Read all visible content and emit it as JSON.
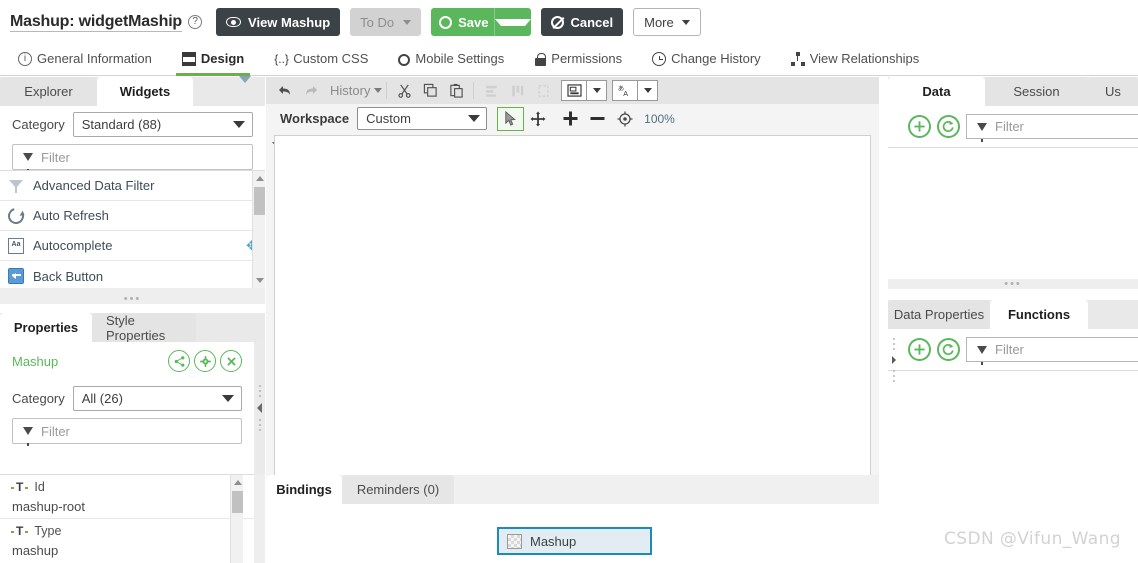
{
  "header": {
    "title_prefix": "Mashup:",
    "title_name": "widgetMaship",
    "help_icon": "question-circle-icon",
    "buttons": {
      "view_mashup": "View Mashup",
      "to_do": "To Do",
      "save": "Save",
      "cancel": "Cancel",
      "more": "More"
    }
  },
  "nav_tabs": [
    {
      "label": "General Information",
      "icon": "info-icon",
      "active": false
    },
    {
      "label": "Design",
      "icon": "design-icon",
      "active": true
    },
    {
      "label": "Custom CSS",
      "icon": "css-braces-icon",
      "active": false
    },
    {
      "label": "Mobile Settings",
      "icon": "gear-icon",
      "active": false
    },
    {
      "label": "Permissions",
      "icon": "lock-icon",
      "active": false
    },
    {
      "label": "Change History",
      "icon": "clock-icon",
      "active": false
    },
    {
      "label": "View Relationships",
      "icon": "hierarchy-icon",
      "active": false
    }
  ],
  "widgets_panel": {
    "tabs": [
      {
        "label": "Explorer",
        "active": false
      },
      {
        "label": "Widgets",
        "active": true
      }
    ],
    "collapse_icon": "chevron-down-icon",
    "category_label": "Category",
    "category_value": "Standard (88)",
    "filter_placeholder": "Filter",
    "items": [
      {
        "label": "Advanced Data Filter",
        "icon": "funnel-icon",
        "draggable": false
      },
      {
        "label": "Auto Refresh",
        "icon": "refresh-icon",
        "draggable": false
      },
      {
        "label": "Autocomplete",
        "icon": "autocomplete-icon",
        "draggable": true
      },
      {
        "label": "Back Button",
        "icon": "back-button-icon",
        "draggable": false
      }
    ]
  },
  "properties_panel": {
    "tabs": [
      {
        "label": "Properties",
        "active": true
      },
      {
        "label": "Style Properties",
        "active": false
      }
    ],
    "entity_name": "Mashup",
    "actions": [
      {
        "name": "share-button",
        "icon": "share-icon"
      },
      {
        "name": "configure-button",
        "icon": "gear-icon"
      },
      {
        "name": "close-button",
        "icon": "close-icon"
      }
    ],
    "category_label": "Category",
    "category_value": "All (26)",
    "filter_placeholder": "Filter",
    "rows": [
      {
        "key": "Id",
        "value": "mashup-root",
        "icon": "text-type-icon"
      },
      {
        "key": "Type",
        "value": "mashup",
        "icon": "text-type-icon"
      }
    ]
  },
  "canvas_toolbar": {
    "undo": "undo-icon",
    "redo": "redo-icon",
    "history_label": "History",
    "cut": "cut-icon",
    "copy": "copy-icon",
    "paste": "paste-icon",
    "align_h": "align-horizontal-icon",
    "align_v": "align-vertical-icon",
    "fit": "fit-icon",
    "layout_icon": "layout-icon",
    "language_icon": "language-icon",
    "workspace_label": "Workspace",
    "workspace_value": "Custom",
    "tool_select": "cursor-select-icon",
    "tool_pan": "pan-move-icon",
    "zoom_in": "zoom-in-icon",
    "zoom_out": "zoom-out-icon",
    "zoom_reset": "zoom-reset-icon",
    "zoom_level": "100%"
  },
  "bindings_panel": {
    "tabs": [
      {
        "label": "Bindings",
        "active": true
      },
      {
        "label": "Reminders (0)",
        "active": false
      }
    ],
    "node_label": "Mashup",
    "node_icon": "mashup-node-icon"
  },
  "data_panel": {
    "tabs": [
      {
        "label": "Data",
        "active": true
      },
      {
        "label": "Session",
        "active": false
      },
      {
        "label": "Us",
        "active": false
      }
    ],
    "add_icon": "plus-circle-icon",
    "refresh_icon": "refresh-circle-icon",
    "filter_placeholder": "Filter"
  },
  "functions_panel": {
    "tabs": [
      {
        "label": "Data Properties",
        "active": false
      },
      {
        "label": "Functions",
        "active": true
      }
    ],
    "add_icon": "plus-circle-icon",
    "refresh_icon": "refresh-circle-icon",
    "filter_placeholder": "Filter"
  },
  "watermark": "CSDN @Vifun_Wang",
  "colors": {
    "accent_green": "#5bb75b",
    "dark": "#3c4347",
    "active_tab_underline": "#6ab04c",
    "node_border": "#1a8cba",
    "node_fill": "#e2edf3"
  }
}
